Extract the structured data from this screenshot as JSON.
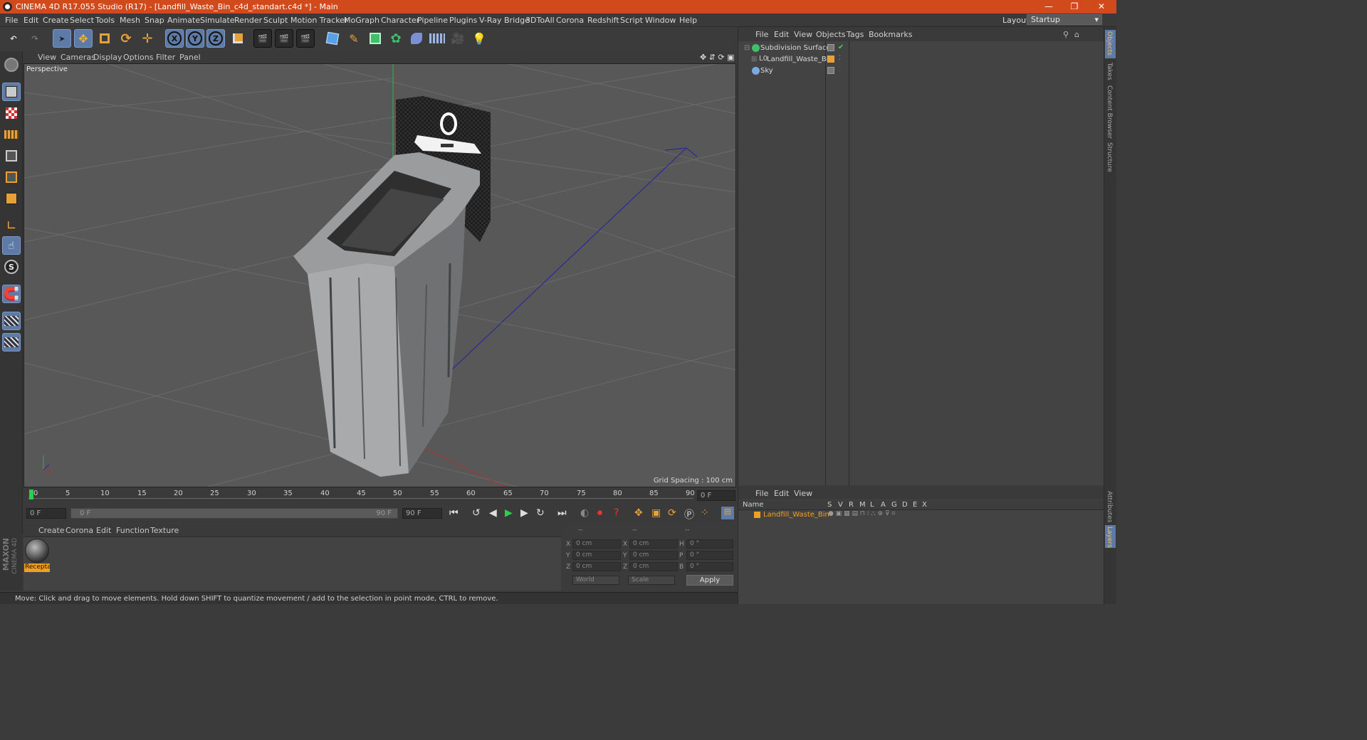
{
  "window": {
    "title": "CINEMA 4D R17.055 Studio (R17) - [Landfill_Waste_Bin_c4d_standart.c4d *] - Main",
    "minimize": "—",
    "restore": "❐",
    "close": "✕"
  },
  "menu": [
    "File",
    "Edit",
    "Create",
    "Select",
    "Tools",
    "Mesh",
    "Snap",
    "Animate",
    "Simulate",
    "Render",
    "Sculpt",
    "Motion Tracker",
    "MoGraph",
    "Character",
    "Pipeline",
    "Plugins",
    "V-Ray Bridge",
    "3DToAll",
    "Corona",
    "Redshift",
    "Script",
    "Window",
    "Help"
  ],
  "layout": {
    "label": "Layout:",
    "value": "Startup"
  },
  "toolbar": {
    "axis_x": "X",
    "axis_y": "Y",
    "axis_z": "Z"
  },
  "viewport": {
    "menu": [
      "View",
      "Cameras",
      "Display",
      "Options",
      "Filter",
      "Panel"
    ],
    "label": "Perspective",
    "grid_spacing": "Grid Spacing : 100 cm"
  },
  "timeline": {
    "ticks": [
      "0",
      "5",
      "10",
      "15",
      "20",
      "25",
      "30",
      "35",
      "40",
      "45",
      "50",
      "55",
      "60",
      "65",
      "70",
      "75",
      "80",
      "85",
      "90"
    ],
    "current_frame": "0 F",
    "start_field": "0 F",
    "range_start": "0 F",
    "range_end": "90 F",
    "end_field": "90 F"
  },
  "material_menu": [
    "Create",
    "Corona",
    "Edit",
    "Function",
    "Texture"
  ],
  "material": {
    "name": "Recepta"
  },
  "coords": {
    "header": [
      "--",
      "--",
      "--"
    ],
    "rows": [
      {
        "l1": "X",
        "v1": "0 cm",
        "l2": "X",
        "v2": "0 cm",
        "l3": "H",
        "v3": "0 °"
      },
      {
        "l1": "Y",
        "v1": "0 cm",
        "l2": "Y",
        "v2": "0 cm",
        "l3": "P",
        "v3": "0 °"
      },
      {
        "l1": "Z",
        "v1": "0 cm",
        "l2": "Z",
        "v2": "0 cm",
        "l3": "B",
        "v3": "0 °"
      }
    ],
    "world": "World",
    "scale": "Scale",
    "apply": "Apply"
  },
  "status": "Move: Click and drag to move elements. Hold down SHIFT to quantize movement / add to the selection in point mode, CTRL to remove.",
  "objects_panel": {
    "menu": [
      "File",
      "Edit",
      "View",
      "Objects",
      "Tags",
      "Bookmarks"
    ],
    "items": [
      "Subdivision Surface",
      "Landfill_Waste_Bin",
      "Sky"
    ]
  },
  "layers_panel": {
    "menu": [
      "File",
      "Edit",
      "View"
    ],
    "header_name": "Name",
    "columns": [
      "S",
      "V",
      "R",
      "M",
      "L",
      "A",
      "G",
      "D",
      "E",
      "X"
    ],
    "items": [
      "Landfill_Waste_Bin"
    ]
  },
  "side_tabs": [
    "Objects",
    "Takes",
    "Content Browser",
    "Structure",
    "Attributes",
    "Layers"
  ],
  "maxon": {
    "line1": "MAXON",
    "line2": "CINEMA 4D"
  },
  "colors": {
    "title": "#d14a1c",
    "accent": "#e8a13a",
    "selected": "#5e7aa6",
    "layer_name": "#f0a020"
  }
}
